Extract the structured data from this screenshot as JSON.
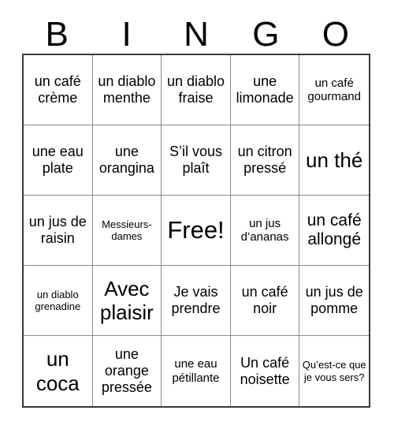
{
  "card": {
    "title": "BINGO",
    "free_space_label": "Free!",
    "header": {
      "letters": [
        "B",
        "I",
        "N",
        "G",
        "O"
      ]
    },
    "grid": {
      "columns": 5,
      "rows": 5,
      "border_color": "#3a3a3a",
      "cell_line_color": "#8a8a8a",
      "background_color": "#ffffff",
      "text_color": "#000000"
    },
    "cells": [
      {
        "text": "un café crème",
        "size": "m"
      },
      {
        "text": "un diablo menthe",
        "size": "m"
      },
      {
        "text": "un diablo fraise",
        "size": "m"
      },
      {
        "text": "une limonade",
        "size": "m"
      },
      {
        "text": "un café gourmand",
        "size": "s"
      },
      {
        "text": "une eau plate",
        "size": "m"
      },
      {
        "text": "une orangina",
        "size": "m"
      },
      {
        "text": "S’il vous plaît",
        "size": "m"
      },
      {
        "text": "un citron pressé",
        "size": "m"
      },
      {
        "text": "un thé",
        "size": "xl"
      },
      {
        "text": "un jus de raisin",
        "size": "m"
      },
      {
        "text": "Messieurs-dames",
        "size": "xs"
      },
      {
        "text": "Free!",
        "size": "xxl"
      },
      {
        "text": "un jus d’ananas",
        "size": "s"
      },
      {
        "text": "un café allongé",
        "size": "l"
      },
      {
        "text": "un diablo grenadine",
        "size": "xs"
      },
      {
        "text": "Avec plaisir",
        "size": "xl"
      },
      {
        "text": "Je vais prendre",
        "size": "m"
      },
      {
        "text": "un café noir",
        "size": "m"
      },
      {
        "text": "un jus de pomme",
        "size": "m"
      },
      {
        "text": "un coca",
        "size": "xl"
      },
      {
        "text": "une orange pressée",
        "size": "m"
      },
      {
        "text": "une eau pétillante",
        "size": "s"
      },
      {
        "text": "Un café noisette",
        "size": "m"
      },
      {
        "text": "Qu’est-ce que je vous sers?",
        "size": "xs"
      }
    ]
  }
}
